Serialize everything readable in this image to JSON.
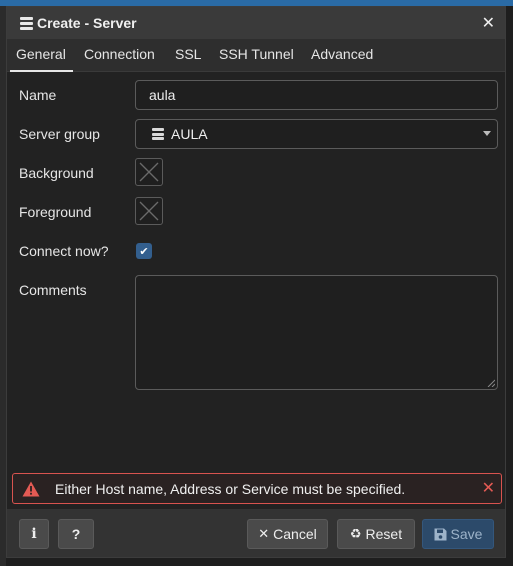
{
  "dialog": {
    "title": "Create - Server",
    "tabs": [
      "General",
      "Connection",
      "SSL",
      "SSH Tunnel",
      "Advanced"
    ],
    "active_tab": "General"
  },
  "form": {
    "name_label": "Name",
    "name_value": "aula",
    "server_group_label": "Server group",
    "server_group_value": "AULA",
    "background_label": "Background",
    "foreground_label": "Foreground",
    "connect_now_label": "Connect now?",
    "connect_now_checked": true,
    "comments_label": "Comments",
    "comments_value": ""
  },
  "error": {
    "message": "Either Host name, Address or Service must be specified."
  },
  "footer": {
    "info_label": "i",
    "help_label": "?",
    "cancel_label": "Cancel",
    "reset_label": "Reset",
    "save_label": "Save"
  },
  "colors": {
    "error_border": "#d9534f",
    "checkbox_accent": "#335f8e",
    "save_button": "#2c4a6a"
  },
  "icons": [
    "server-group-icon",
    "close-icon",
    "warning-icon",
    "info-icon",
    "help-icon",
    "cancel-icon",
    "reset-icon",
    "save-icon",
    "checkmark-icon",
    "caret-down-icon"
  ]
}
